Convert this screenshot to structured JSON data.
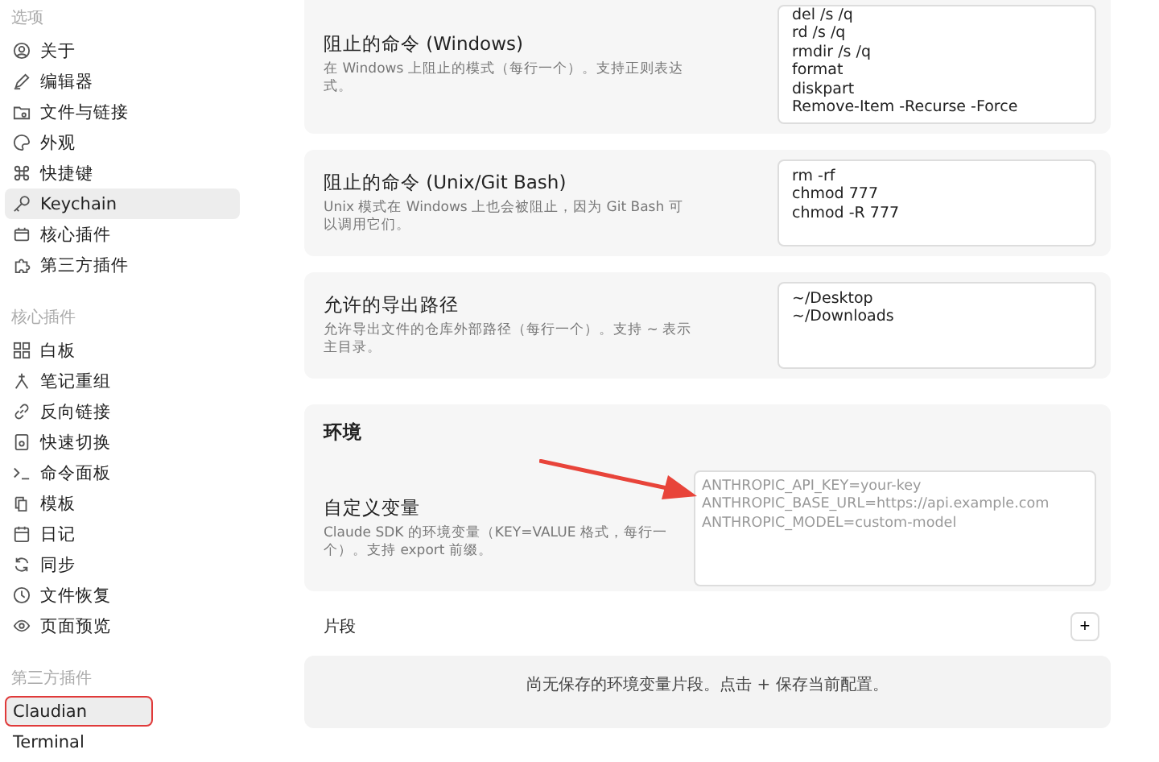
{
  "sidebar": {
    "groups": [
      {
        "title": "选项",
        "items": [
          {
            "label": "关于",
            "selected": false,
            "highlighted": false
          },
          {
            "label": "编辑器",
            "selected": false,
            "highlighted": false
          },
          {
            "label": "文件与链接",
            "selected": false,
            "highlighted": false
          },
          {
            "label": "外观",
            "selected": false,
            "highlighted": false
          },
          {
            "label": "快捷键",
            "selected": false,
            "highlighted": false
          },
          {
            "label": "Keychain",
            "selected": true,
            "highlighted": false
          },
          {
            "label": "核心插件",
            "selected": false,
            "highlighted": false
          },
          {
            "label": "第三方插件",
            "selected": false,
            "highlighted": false
          }
        ]
      },
      {
        "title": "核心插件",
        "items": [
          {
            "label": "白板",
            "selected": false,
            "highlighted": false
          },
          {
            "label": "笔记重组",
            "selected": false,
            "highlighted": false
          },
          {
            "label": "反向链接",
            "selected": false,
            "highlighted": false
          },
          {
            "label": "快速切换",
            "selected": false,
            "highlighted": false
          },
          {
            "label": "命令面板",
            "selected": false,
            "highlighted": false
          },
          {
            "label": "模板",
            "selected": false,
            "highlighted": false
          },
          {
            "label": "日记",
            "selected": false,
            "highlighted": false
          },
          {
            "label": "同步",
            "selected": false,
            "highlighted": false
          },
          {
            "label": "文件恢复",
            "selected": false,
            "highlighted": false
          },
          {
            "label": "页面预览",
            "selected": false,
            "highlighted": false
          }
        ]
      },
      {
        "title": "第三方插件",
        "items": [
          {
            "label": "Claudian",
            "selected": true,
            "highlighted": true
          },
          {
            "label": "Terminal",
            "selected": false,
            "highlighted": false
          }
        ]
      }
    ]
  },
  "settings": [
    {
      "title": "阻止的命令 (Windows)",
      "description": "在 Windows 上阻止的模式（每行一个）。支持正则表达式。",
      "value": "del /s /q\nrd /s /q\nrmdir /s /q\nformat\ndiskpart\nRemove-Item -Recurse -Force"
    },
    {
      "title": "阻止的命令 (Unix/Git Bash)",
      "description": "Unix 模式在 Windows 上也会被阻止，因为 Git Bash 可以调用它们。",
      "value": "rm -rf\nchmod 777\nchmod -R 777"
    },
    {
      "title": "允许的导出路径",
      "description": "允许导出文件的仓库外部路径（每行一个）。支持 ~ 表示主目录。",
      "value": "~/Desktop\n~/Downloads"
    }
  ],
  "environment": {
    "heading": "环境",
    "setting": {
      "title": "自定义变量",
      "description": "Claude SDK 的环境变量（KEY=VALUE 格式，每行一个）。支持 export 前缀。",
      "placeholder": "ANTHROPIC_API_KEY=your-key\nANTHROPIC_BASE_URL=https://api.example.com\nANTHROPIC_MODEL=custom-model"
    }
  },
  "snippets": {
    "label": "片段",
    "add_button": "+",
    "empty_message": "尚无保存的环境变量片段。点击 + 保存当前配置。"
  }
}
